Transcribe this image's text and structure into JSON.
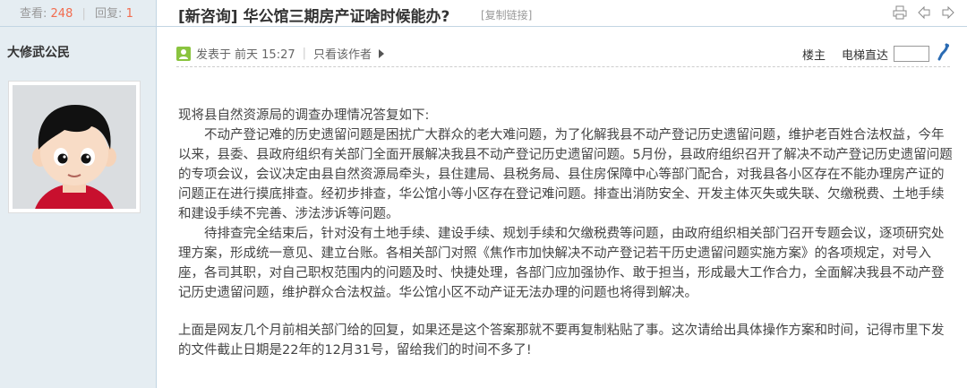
{
  "stats": {
    "views_label": "查看:",
    "views": "248",
    "replies_label": "回复:",
    "replies": "1"
  },
  "thread": {
    "title": "[新咨询] 华公馆三期房产证啥时候能办?",
    "copy_link": "[复制链接]"
  },
  "author": {
    "name": "大修武公民"
  },
  "post": {
    "posted_prefix": "发表于",
    "posted_time": "前天 15:27",
    "only_author": "只看该作者",
    "floor": "楼主",
    "jump_label": "电梯直达",
    "paragraphs": [
      "现将县自然资源局的调查办理情况答复如下:",
      "不动产登记难的历史遗留问题是困扰广大群众的老大难问题，为了化解我县不动产登记历史遗留问题，维护老百姓合法权益，今年以来，县委、县政府组织有关部门全面开展解决我县不动产登记历史遗留问题。5月份，县政府组织召开了解决不动产登记历史遗留问题的专项会议，会议决定由县自然资源局牵头，县住建局、县税务局、县住房保障中心等部门配合，对我县各小区存在不能办理房产证的问题正在进行摸底排查。经初步排查，华公馆小等小区存在登记难问题。排查出消防安全、开发主体灭失或失联、欠缴税费、土地手续和建设手续不完善、涉法涉诉等问题。",
      "待排查完全结束后，针对没有土地手续、建设手续、规划手续和欠缴税费等问题，由政府组织相关部门召开专题会议，逐项研究处理方案，形成统一意见、建立台账。各相关部门对照《焦作市加快解决不动产登记若干历史遗留问题实施方案》的各项规定，对号入座，各司其职，对自己职权范围内的问题及时、快捷处理，各部门应加强协作、敢于担当，形成最大工作合力，全面解决我县不动产登记历史遗留问题，维护群众合法权益。华公馆小区不动产证无法办理的问题也将得到解决。",
      "上面是网友几个月前相关部门给的回复，如果还是这个答案那就不要再复制粘贴了事。这次请给出具体操作方案和时间，记得市里下发的文件截止日期是22年的12月31号，留给我们的时间不多了!"
    ]
  },
  "colors": {
    "sidebar_bg": "#e5edf2",
    "border": "#c2d5e3",
    "accent": "#f26c4f"
  }
}
